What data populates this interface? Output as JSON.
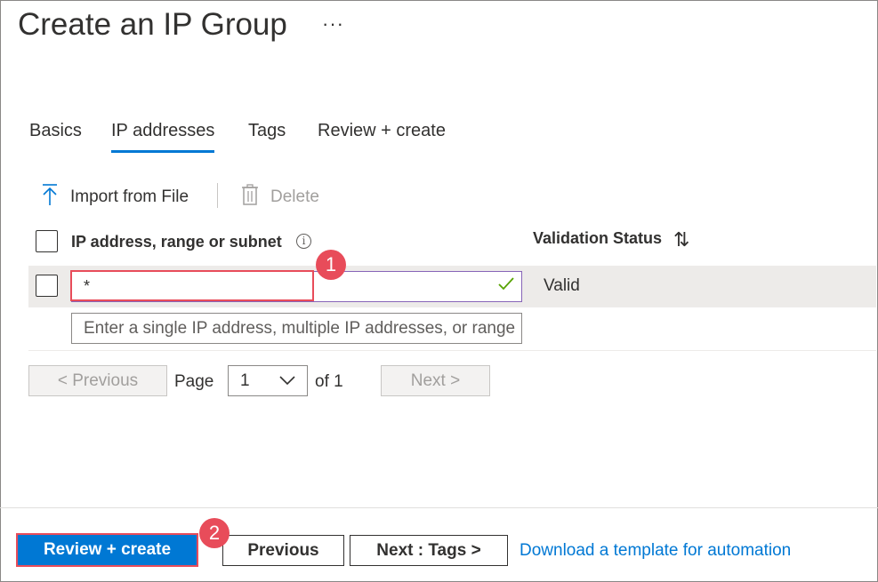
{
  "page": {
    "title": "Create an IP Group",
    "more_label": "···"
  },
  "tabs": [
    {
      "label": "Basics",
      "active": false
    },
    {
      "label": "IP addresses",
      "active": true
    },
    {
      "label": "Tags",
      "active": false
    },
    {
      "label": "Review + create",
      "active": false
    }
  ],
  "toolbar": {
    "import_label": "Import from File",
    "import_icon": "upload-arrow-icon",
    "delete_label": "Delete",
    "delete_icon": "trash-icon"
  },
  "table": {
    "columns": [
      {
        "label": "IP address, range or subnet",
        "icon": "info-icon"
      },
      {
        "label": "Validation Status",
        "icon": "sort-icon"
      }
    ],
    "rows": [
      {
        "ip": "*",
        "status": "Valid",
        "checked": false
      }
    ],
    "new_row_placeholder": "Enter a single IP address, multiple IP addresses, or range"
  },
  "pagination": {
    "previous_label": "< Previous",
    "page_label": "Page",
    "page_value": "1",
    "of_label": "of 1",
    "next_label": "Next >"
  },
  "footer": {
    "review_create_label": "Review + create",
    "previous_label": "Previous",
    "next_label": "Next : Tags >",
    "download_link": "Download a template for automation"
  },
  "annotations": {
    "step1": "1",
    "step2": "2"
  },
  "colors": {
    "accent": "#0078d4",
    "highlight": "#e84c5a",
    "valid": "#57a300"
  }
}
